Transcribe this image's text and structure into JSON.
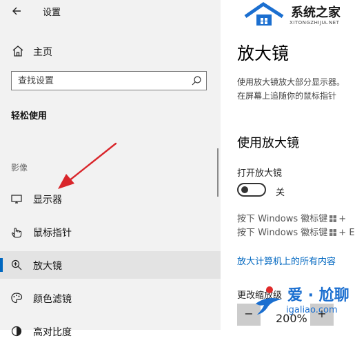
{
  "sidebar": {
    "back_label": "",
    "window_title": "设置",
    "home_label": "主页",
    "search_placeholder": "查找设置",
    "section_title": "轻松使用",
    "group_label": "影像",
    "items": [
      {
        "label": "显示器",
        "icon": "monitor-icon"
      },
      {
        "label": "鼠标指针",
        "icon": "pointer-icon"
      },
      {
        "label": "放大镜",
        "icon": "magnifier-icon",
        "selected": true
      },
      {
        "label": "颜色滤镜",
        "icon": "color-filter-icon"
      },
      {
        "label": "高对比度",
        "icon": "contrast-icon"
      }
    ]
  },
  "main": {
    "logo": {
      "text": "系统之家",
      "subtext": "XITONGZHIJIA.NET"
    },
    "title": "放大镜",
    "desc_lines": [
      "使用放大镜放大部分显示器。",
      "在屏幕上追随你的鼠标指针"
    ],
    "section_title": "使用放大镜",
    "toggle_label": "打开放大镜",
    "toggle_state": "关",
    "shortcut1": {
      "prefix": "按下 Windows 徽标键",
      "suffix": "+"
    },
    "shortcut2": {
      "prefix": "按下 Windows 徽标键",
      "suffix": "+ E"
    },
    "link": "放大计算机上的所有内容",
    "zoom_label": "更改缩放级",
    "zoom_value": "200%",
    "zoom_minus": "−",
    "zoom_plus": "+"
  },
  "watermark": {
    "text": "爱 · 尬聊",
    "sub": "igaliao.com"
  },
  "colors": {
    "accent": "#0067c0",
    "sidebar_bg": "#f2f2f2",
    "arrow": "#d9262b"
  }
}
